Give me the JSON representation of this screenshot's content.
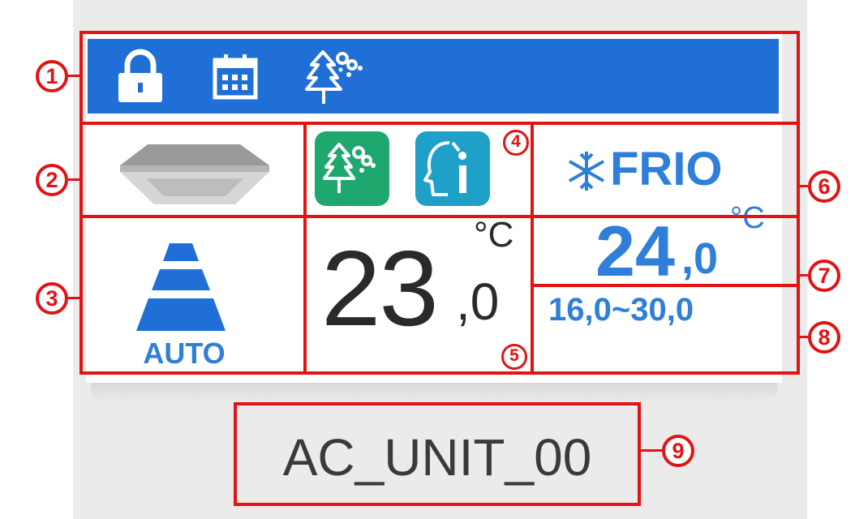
{
  "status_bar": {
    "icons": [
      "lock-icon",
      "calendar-icon",
      "tree-air-icon"
    ],
    "color": "#1f6fd6"
  },
  "unit_type_icon": "cassette-unit-icon",
  "feature_badges": [
    {
      "icon": "tree-air-badge-icon",
      "color": "#1fa86d"
    },
    {
      "icon": "face-info-badge-icon",
      "color": "#1fa0c8"
    }
  ],
  "fan": {
    "mode_label": "AUTO",
    "icon": "fan-speed-levels-icon"
  },
  "room_temp": {
    "integer": "23",
    "decimal": ",0",
    "unit": "°C"
  },
  "mode": {
    "icon": "snowflake-icon",
    "label": "FRIO"
  },
  "setpoint": {
    "integer": "24",
    "decimal": ",0",
    "unit": "°C"
  },
  "range": "16,0~30,0",
  "unit_name": "AC_UNIT_00",
  "callouts": [
    "1",
    "2",
    "3",
    "4",
    "5",
    "6",
    "7",
    "8",
    "9"
  ],
  "colors": {
    "accent_blue": "#2f7fd8",
    "annotation_red": "#e11313"
  }
}
